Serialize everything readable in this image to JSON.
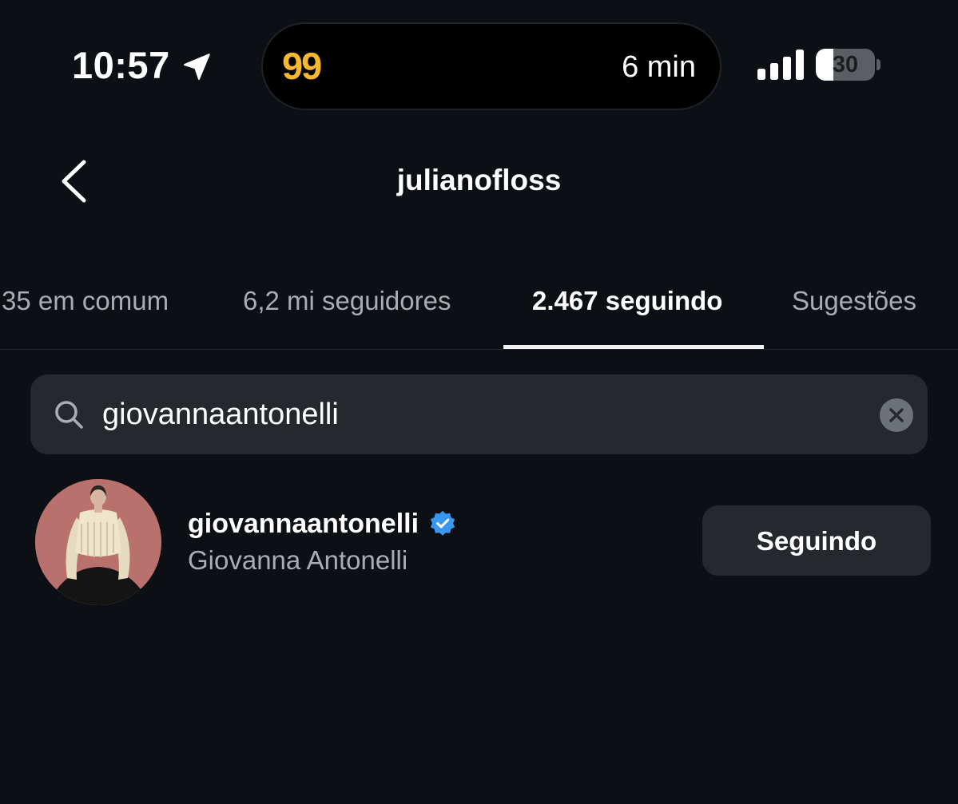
{
  "status_bar": {
    "time": "10:57",
    "location_icon": "location-arrow-icon",
    "island": {
      "logo": "99",
      "eta": "6 min",
      "logo_color": "#f5b82e"
    },
    "signal_icon": "cellular-signal-icon",
    "battery": {
      "level": "30",
      "percent": 30
    }
  },
  "header": {
    "back_icon": "chevron-left-icon",
    "title": "julianofloss"
  },
  "tabs": [
    {
      "label": "35 em comum",
      "active": false
    },
    {
      "label": "6,2 mi seguidores",
      "active": false
    },
    {
      "label": "2.467 seguindo",
      "active": true
    },
    {
      "label": "Sugestões",
      "active": false
    }
  ],
  "search": {
    "icon": "search-icon",
    "value": "giovannaantonelli",
    "placeholder": "Pesquisar",
    "clear_icon": "close-icon"
  },
  "results": [
    {
      "username": "giovannaantonelli",
      "full_name": "Giovanna Antonelli",
      "verified": true,
      "button_label": "Seguindo"
    }
  ],
  "colors": {
    "background": "#0c1014",
    "surface": "#25292e",
    "muted_text": "#a8adb3",
    "verified_blue": "#3897f0"
  }
}
